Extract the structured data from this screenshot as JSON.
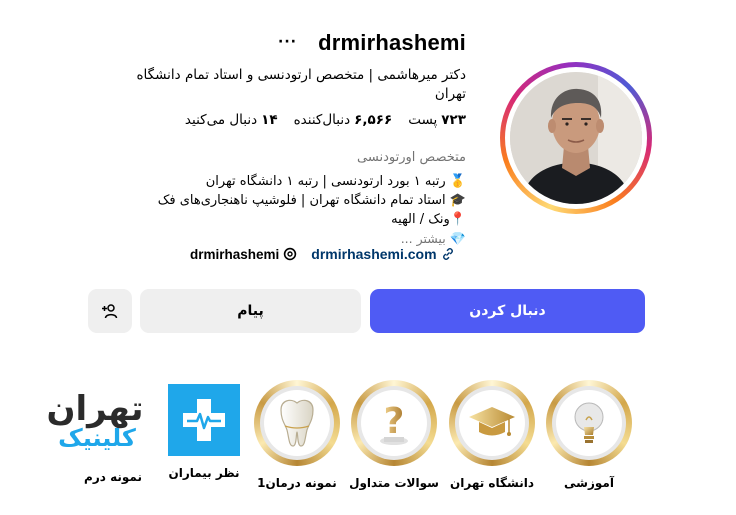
{
  "profile": {
    "username": "drmirhashemi",
    "more_icon": "ellipsis-icon",
    "full_name": "دکتر میرهاشمی | متخصص ارتودنسی و استاد تمام دانشگاه تهران",
    "stats": {
      "posts_value": "۷۲۳",
      "posts_label": "پست",
      "followers_value": "۶,۵۶۶",
      "followers_label": "دنبال‌کننده",
      "following_value": "۱۴",
      "following_label": "دنبال می‌کنید"
    },
    "category": "متخصص اورتودنسی",
    "bio": [
      "🥇 رتبه ۱ بورد ارتودنسی | رتبه ۱ دانشگاه تهران",
      "🎓 استاد تمام دانشگاه تهران | فلوشیپ ناهنجاری‌های فک",
      "📍ونک / الهیه",
      "💎"
    ],
    "more_label": "بیشتر ...",
    "link": "drmirhashemi.com",
    "threads_handle": "drmirhashemi"
  },
  "actions": {
    "follow": "دنبال کردن",
    "message": "پیام",
    "suggest_icon": "add-person-icon"
  },
  "highlights": [
    {
      "label": "آموزشی",
      "icon": "lightbulb-icon"
    },
    {
      "label": "دانشگاه تهران",
      "icon": "graduation-cap-icon"
    },
    {
      "label": "سوالات متداول",
      "icon": "question-mark-icon"
    },
    {
      "label": "نمونه درمان1",
      "icon": "tooth-icon"
    },
    {
      "label": "نظر بیماران",
      "icon": "medical-cross-icon"
    },
    {
      "label": "نمونه درم",
      "icon": "tehran-clinic-logo"
    }
  ],
  "watermark": {
    "line1": "تهران",
    "line2": "کلینیک"
  },
  "colors": {
    "follow_button": "#4f5bf4",
    "secondary_button": "#efefef",
    "link": "#00376b",
    "muted_text": "#737373",
    "clinic_blue": "#1fa7ea",
    "clinic_dark": "#2b2b2b"
  }
}
